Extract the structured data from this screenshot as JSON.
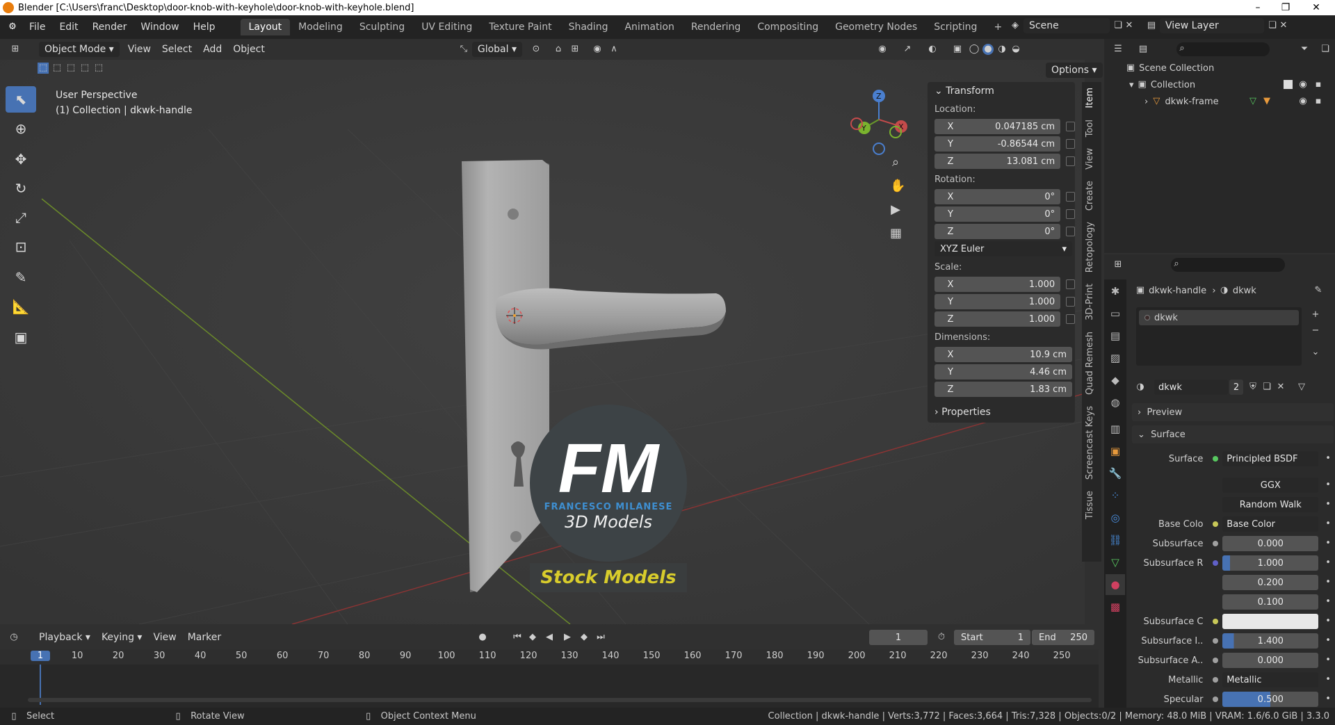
{
  "titlebar": {
    "title": "Blender [C:\\Users\\franc\\Desktop\\door-knob-with-keyhole\\door-knob-with-keyhole.blend]"
  },
  "menu": {
    "items": [
      "File",
      "Edit",
      "Render",
      "Window",
      "Help"
    ]
  },
  "workspaces": [
    "Layout",
    "Modeling",
    "Sculpting",
    "UV Editing",
    "Texture Paint",
    "Shading",
    "Animation",
    "Rendering",
    "Compositing",
    "Geometry Nodes",
    "Scripting"
  ],
  "scene": {
    "name": "Scene",
    "view_layer": "View Layer"
  },
  "header3d": {
    "mode": "Object Mode",
    "view": "View",
    "select": "Select",
    "add": "Add",
    "object": "Object",
    "orientation": "Global",
    "options": "Options"
  },
  "viewport": {
    "perspective": "User Perspective",
    "collection": "(1) Collection | dkwk-handle"
  },
  "logo": {
    "initials": "FM",
    "name": "FRANCESCO MILANESE",
    "sub": "3D Models",
    "banner": "Stock Models"
  },
  "npanel": {
    "transform": "Transform",
    "location_label": "Location:",
    "location": [
      {
        "ax": "X",
        "val": "0.047185 cm"
      },
      {
        "ax": "Y",
        "val": "-0.86544 cm"
      },
      {
        "ax": "Z",
        "val": "13.081 cm"
      }
    ],
    "rotation_label": "Rotation:",
    "rotation": [
      {
        "ax": "X",
        "val": "0°"
      },
      {
        "ax": "Y",
        "val": "0°"
      },
      {
        "ax": "Z",
        "val": "0°"
      }
    ],
    "rotation_mode": "XYZ Euler",
    "scale_label": "Scale:",
    "scale": [
      {
        "ax": "X",
        "val": "1.000"
      },
      {
        "ax": "Y",
        "val": "1.000"
      },
      {
        "ax": "Z",
        "val": "1.000"
      }
    ],
    "dimensions_label": "Dimensions:",
    "dimensions": [
      {
        "ax": "X",
        "val": "10.9 cm"
      },
      {
        "ax": "Y",
        "val": "4.46 cm"
      },
      {
        "ax": "Z",
        "val": "1.83 cm"
      }
    ],
    "properties": "Properties",
    "tabs": [
      "Item",
      "Tool",
      "View",
      "Create",
      "Retopology",
      "3D-Print",
      "Quad Remesh",
      "Screencast Keys",
      "Tissue"
    ]
  },
  "outliner": {
    "scene_collection": "Scene Collection",
    "collection": "Collection",
    "object": "dkwk-frame"
  },
  "props": {
    "object": "dkwk-handle",
    "material": "dkwk",
    "slot": "dkwk",
    "mat_field": "dkwk",
    "users": "2",
    "preview": "Preview",
    "surface_section": "Surface",
    "rows": [
      {
        "label": "Surface",
        "value": "Principled BSDF",
        "dot": "#58c860"
      },
      {
        "label": "",
        "value": "GGX",
        "dot": ""
      },
      {
        "label": "",
        "value": "Random Walk",
        "dot": ""
      },
      {
        "label": "Base Colo",
        "value": "Base Color",
        "dot": "#c8c858"
      },
      {
        "label": "Subsurface",
        "value": "0.000",
        "dot": "#a0a0a0"
      },
      {
        "label": "Subsurface R",
        "value": "1.000",
        "dot": "#6060c8"
      },
      {
        "label": "",
        "value": "0.200",
        "dot": ""
      },
      {
        "label": "",
        "value": "0.100",
        "dot": ""
      },
      {
        "label": "Subsurface C",
        "value": "",
        "dot": "#c8c858"
      },
      {
        "label": "Subsurface I..",
        "value": "1.400",
        "dot": "#a0a0a0"
      },
      {
        "label": "Subsurface A..",
        "value": "0.000",
        "dot": "#a0a0a0"
      },
      {
        "label": "Metallic",
        "value": "Metallic",
        "dot": "#a0a0a0"
      },
      {
        "label": "Specular",
        "value": "0.500",
        "dot": "#a0a0a0"
      }
    ]
  },
  "timeline": {
    "playback": "Playback",
    "keying": "Keying",
    "view": "View",
    "marker": "Marker",
    "current": "1",
    "start_label": "Start",
    "start": "1",
    "end_label": "End",
    "end": "250",
    "ticks": [
      "1",
      "10",
      "20",
      "30",
      "40",
      "50",
      "60",
      "70",
      "80",
      "90",
      "100",
      "110",
      "120",
      "130",
      "140",
      "150",
      "160",
      "170",
      "180",
      "190",
      "200",
      "210",
      "220",
      "230",
      "240",
      "250"
    ]
  },
  "status": {
    "select": "Select",
    "rotate": "Rotate View",
    "context": "Object Context Menu",
    "info": "Collection | dkwk-handle | Verts:3,772 | Faces:3,664 | Tris:7,328 | Objects:0/2 | Memory: 48.0 MiB | VRAM: 1.6/6.0 GiB | 3.3.0"
  },
  "colors": {
    "accent": "#4772b3",
    "header": "#232323",
    "panel": "#2b2b2b"
  }
}
